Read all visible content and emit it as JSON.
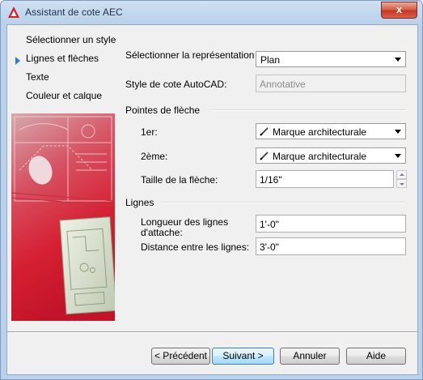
{
  "window": {
    "title": "Assistant de cote AEC",
    "close_glyph": "x"
  },
  "nav": {
    "items": [
      {
        "label": "Sélectionner un style",
        "current": false
      },
      {
        "label": "Lignes et flèches",
        "current": true
      },
      {
        "label": "Texte",
        "current": false
      },
      {
        "label": "Couleur et calque",
        "current": false
      }
    ]
  },
  "form": {
    "display_rep_label": "Sélectionner la représentation d'affichage:",
    "display_rep_value": "Plan",
    "autocad_style_label": "Style de cote AutoCAD:",
    "autocad_style_value": "Annotative",
    "arrowheads_group": "Pointes de flèche",
    "first_label": "1er:",
    "first_value": "Marque architecturale",
    "second_label": "2ème:",
    "second_value": "Marque architecturale",
    "arrow_size_label": "Taille de la flèche:",
    "arrow_size_value": "1/16\"",
    "lines_group": "Lignes",
    "extension_length_label": "Longueur des lignes d'attache:",
    "extension_length_value": "1'-0\"",
    "line_spacing_label": "Distance entre les lignes:",
    "line_spacing_value": "3'-0\""
  },
  "buttons": {
    "back": "< Précédent",
    "next": "Suivant >",
    "cancel": "Annuler",
    "help": "Aide"
  },
  "icons": {
    "app": "autocad-a-icon",
    "arrow_style": "pencil-icon",
    "current_step": "triangle-right-icon"
  },
  "colors": {
    "accent": "#3a79c8",
    "close": "#c3361f",
    "illustration_red": "#d8283a"
  }
}
